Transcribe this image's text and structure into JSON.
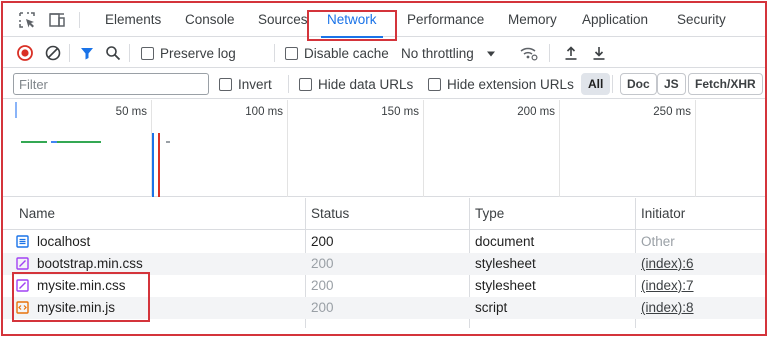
{
  "tabs": [
    {
      "label": "Elements"
    },
    {
      "label": "Console"
    },
    {
      "label": "Sources"
    },
    {
      "label": "Network"
    },
    {
      "label": "Performance"
    },
    {
      "label": "Memory"
    },
    {
      "label": "Application"
    },
    {
      "label": "Security"
    }
  ],
  "active_tab": "Network",
  "toolbar": {
    "preserve_log": "Preserve log",
    "disable_cache": "Disable cache",
    "throttling": "No throttling"
  },
  "filter": {
    "placeholder": "Filter",
    "invert": "Invert",
    "hide_data_urls": "Hide data URLs",
    "hide_extension_urls": "Hide extension URLs",
    "chips": [
      "All",
      "Doc",
      "JS",
      "Fetch/XHR"
    ]
  },
  "timeline": {
    "labels": [
      "50 ms",
      "100 ms",
      "150 ms",
      "200 ms",
      "250 ms"
    ]
  },
  "table": {
    "headers": {
      "name": "Name",
      "status": "Status",
      "type": "Type",
      "initiator": "Initiator"
    },
    "rows": [
      {
        "name": "localhost",
        "status": "200",
        "type": "document",
        "initiator": "Other",
        "icon": "document-icon"
      },
      {
        "name": "bootstrap.min.css",
        "status": "200",
        "type": "stylesheet",
        "initiator": "(index):6",
        "icon": "stylesheet-icon"
      },
      {
        "name": "mysite.min.css",
        "status": "200",
        "type": "stylesheet",
        "initiator": "(index):7",
        "icon": "stylesheet-icon"
      },
      {
        "name": "mysite.min.js",
        "status": "200",
        "type": "script",
        "initiator": "(index):8",
        "icon": "script-icon"
      }
    ]
  },
  "colors": {
    "accent": "#1a73e8",
    "highlight": "#d4343b",
    "record": "#d93025",
    "css_icon": "#a142f4",
    "js_icon": "#e8710a"
  }
}
